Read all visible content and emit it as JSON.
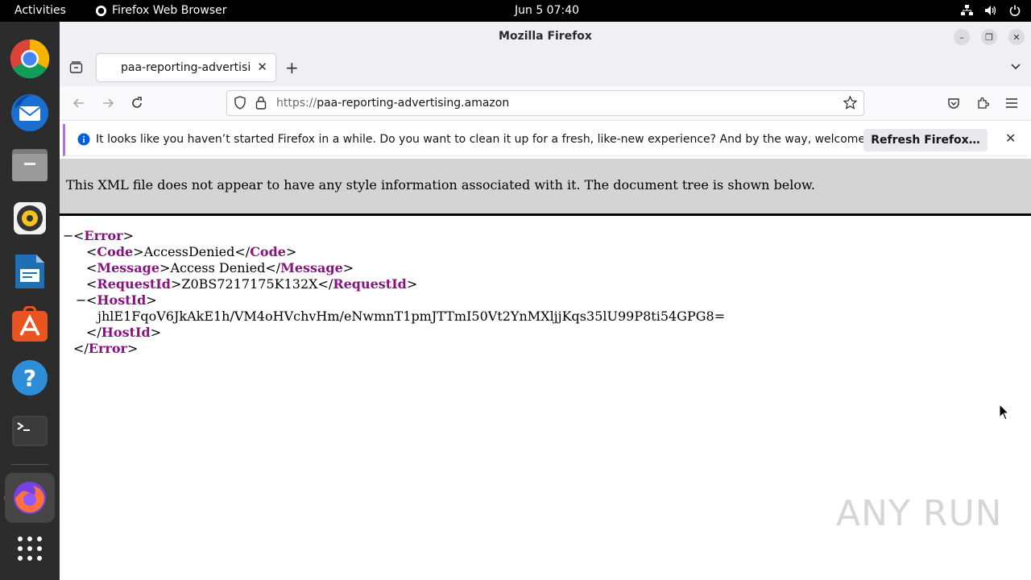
{
  "topbar": {
    "activities": "Activities",
    "app_name": "Firefox Web Browser",
    "clock": "Jun 5  07:40"
  },
  "dock": {
    "items": [
      "chrome-icon",
      "thunderbird-icon",
      "files-icon",
      "rhythmbox-icon",
      "writer-icon",
      "app-center-icon",
      "help-icon",
      "terminal-icon",
      "firefox-icon",
      "show-apps-icon"
    ]
  },
  "window": {
    "title": "Mozilla Firefox"
  },
  "tabs": [
    {
      "title": "paa-reporting-advertising.amazon"
    }
  ],
  "urlbar": {
    "protocol": "https://",
    "host": "paa-reporting-advertising.amazon"
  },
  "notification": {
    "text": "It looks like you haven’t started Firefox in a while. Do you want to clean it up for a fresh, like-new experience? And by the way, welcome back!",
    "button": "Refresh Firefox…"
  },
  "xml": {
    "header": "This XML file does not appear to have any style information associated with it. The document tree is shown below.",
    "root": "Error",
    "code_tag": "Code",
    "code": "AccessDenied",
    "message_tag": "Message",
    "message": "Access Denied",
    "requestid_tag": "RequestId",
    "requestid": "Z0BS7217175K132X",
    "hostid_tag": "HostId",
    "hostid": "jhlE1FqoV6JkAkE1h/VM4oHVchvHm/eNwmnT1pmJTTmI50Vt2YnMXljjKqs35lU99P8ti54GPG8="
  },
  "watermark": "ANY RUN"
}
